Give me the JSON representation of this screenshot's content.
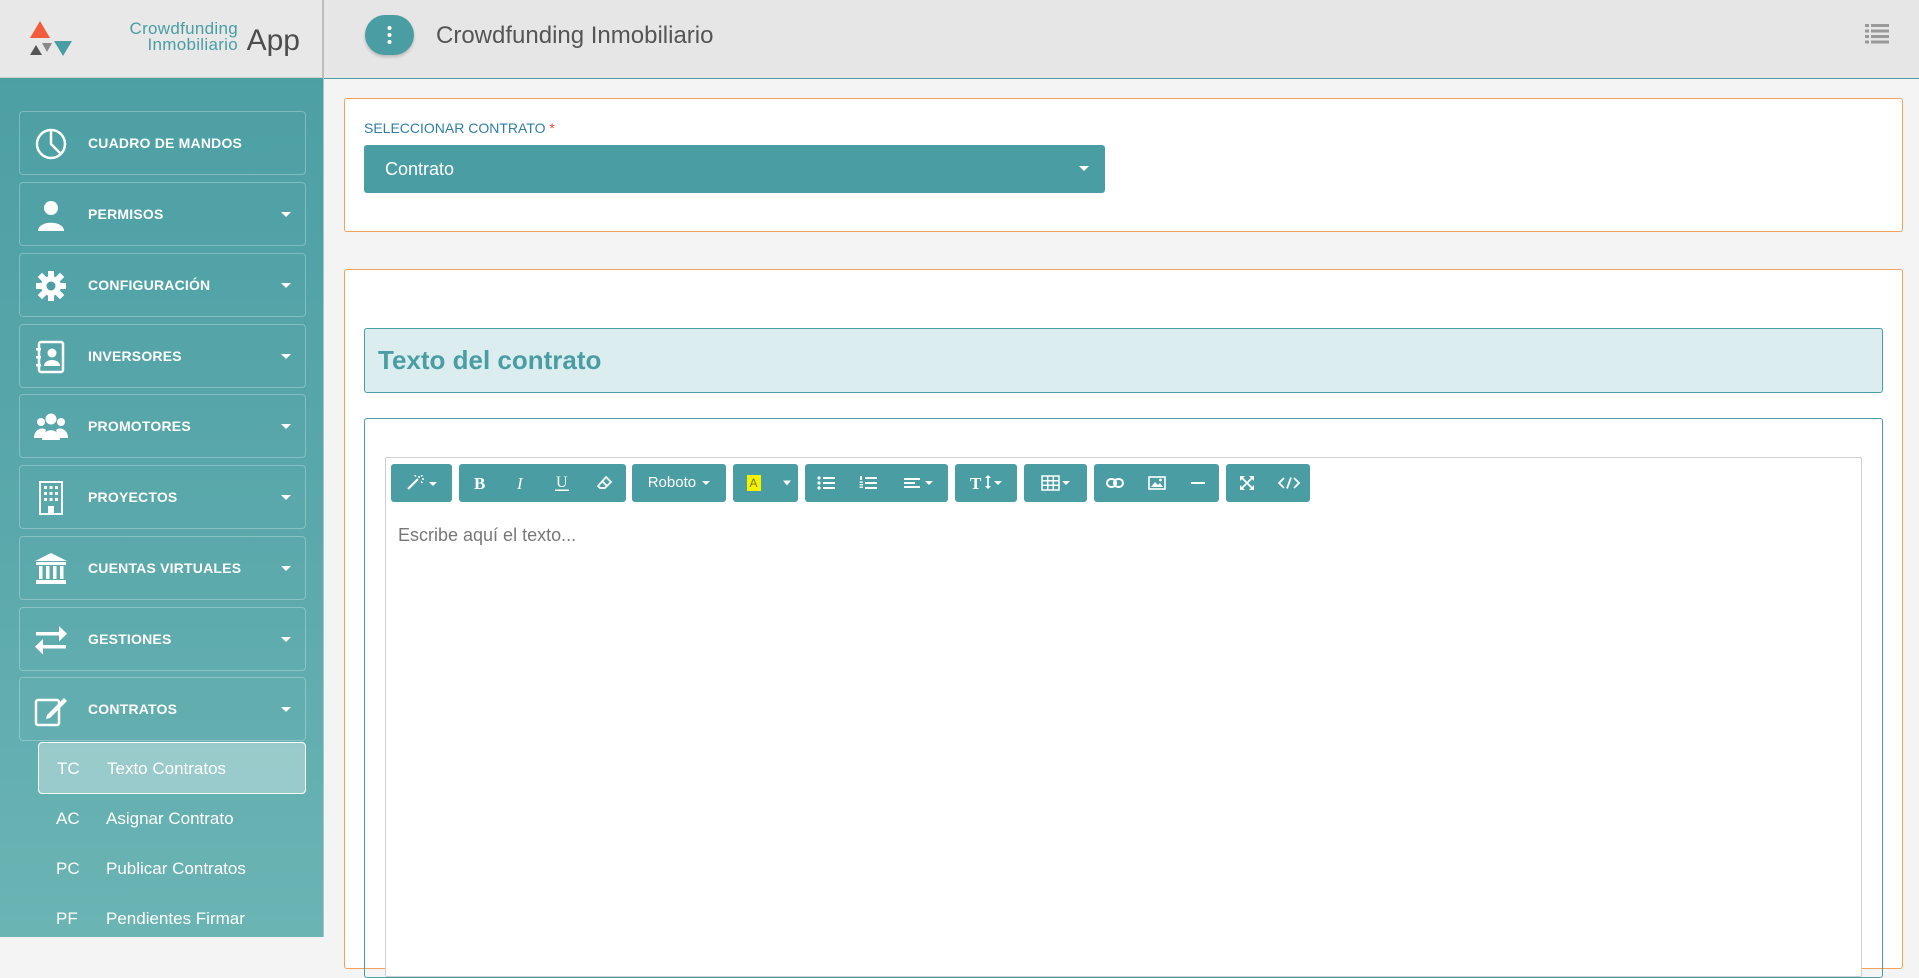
{
  "app": {
    "logo_line1": "Crowdfunding",
    "logo_line2": "Inmobiliario",
    "logo_app": "App",
    "header_title": "Crowdfunding Inmobiliario"
  },
  "sidebar": {
    "items": [
      {
        "label": "CUADRO DE MANDOS",
        "icon": "dashboard-icon"
      },
      {
        "label": "PERMISOS",
        "icon": "user-icon"
      },
      {
        "label": "CONFIGURACIÓN",
        "icon": "gear-icon"
      },
      {
        "label": "INVERSORES",
        "icon": "contact-book-icon"
      },
      {
        "label": "PROMOTORES",
        "icon": "group-icon"
      },
      {
        "label": "PROYECTOS",
        "icon": "building-icon"
      },
      {
        "label": "CUENTAS VIRTUALES",
        "icon": "bank-icon"
      },
      {
        "label": "GESTIONES",
        "icon": "transfer-icon"
      },
      {
        "label": "CONTRATOS",
        "icon": "edit-icon"
      }
    ],
    "subitems": [
      {
        "abbr": "TC",
        "label": "Texto Contratos"
      },
      {
        "abbr": "AC",
        "label": "Asignar Contrato"
      },
      {
        "abbr": "PC",
        "label": "Publicar Contratos"
      },
      {
        "abbr": "PF",
        "label": "Pendientes Firmar"
      }
    ]
  },
  "select_card": {
    "label": "SELECCIONAR CONTRATO",
    "required_mark": "*",
    "value": "Contrato"
  },
  "editor_card": {
    "title": "Texto del contrato",
    "font_name": "Roboto",
    "placeholder": "Escribe aquí el texto..."
  },
  "colors": {
    "accent": "#4a9ea3",
    "card_border": "#f0a35c",
    "required": "#e84b3c"
  }
}
